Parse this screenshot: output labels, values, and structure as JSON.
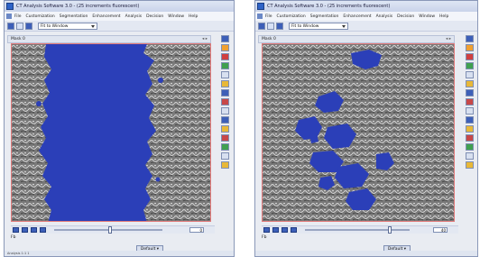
{
  "windows": [
    {
      "title": "CT Analysis Software 3.0 - (25 increments fluorescent)",
      "menu": [
        "File",
        "Customization",
        "Segmentation",
        "Enhancement",
        "Analysis",
        "Decision",
        "Window",
        "Help"
      ],
      "zoom": "Fit to Window",
      "panel_title": "Mask 0",
      "panel_controls": "◂ ▸",
      "slider_value": "0",
      "fb_label": "Fb",
      "default_label": "Default ▾",
      "footer_text": "Analysis 1:1 1"
    },
    {
      "title": "CT Analysis Software 3.0 - (25 increments fluorescent)",
      "menu": [
        "File",
        "Customization",
        "Segmentation",
        "Enhancement",
        "Analysis",
        "Decision",
        "Window",
        "Help"
      ],
      "zoom": "Fit to Window",
      "panel_title": "Mask 0",
      "panel_controls": "◂ ▸",
      "slider_value": "40",
      "fb_label": "Fb",
      "default_label": "Default ▾",
      "footer_text": ""
    }
  ],
  "colors": {
    "mask_blue": "#2b3fb8",
    "cell_gray": "#7d7d7d",
    "border_red": "#e27a7a",
    "toolbar_blue": "#3d5fb8"
  }
}
